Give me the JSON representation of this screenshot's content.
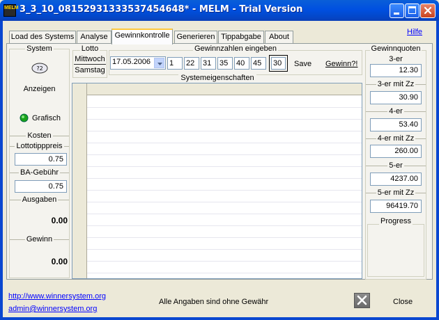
{
  "window": {
    "title": "3_3_10_08152931333537454648* - MELM - Trial Version",
    "icon_text": "MELM"
  },
  "tabs": [
    {
      "label": "Load des Systems",
      "active": false
    },
    {
      "label": "Analyse",
      "active": false
    },
    {
      "label": "Gewinnkontrolle",
      "active": true
    },
    {
      "label": "Generieren",
      "active": false
    },
    {
      "label": "Tippabgabe",
      "active": false
    },
    {
      "label": "About",
      "active": false
    }
  ],
  "help_link": "Hilfe",
  "system": {
    "group_label": "System",
    "show_label": "Anzeigen",
    "graphic_label": "Grafisch"
  },
  "costs": {
    "group_label": "Kosten",
    "lotto_price_label": "Lottotipppreis",
    "lotto_price_value": "0.75",
    "ba_fee_label": "BA-Gebühr",
    "ba_fee_value": "0.75",
    "expenses_label": "Ausgaben",
    "expenses_value": "0.00",
    "win_label": "Gewinn",
    "win_value": "0.00"
  },
  "lotto": {
    "group_label": "Lotto",
    "wednesday": "Mittwoch",
    "saturday": "Samstag"
  },
  "draw": {
    "group_label": "Gewinnzahlen eingeben",
    "date": "17.05.2006",
    "numbers": [
      "1",
      "22",
      "31",
      "35",
      "40",
      "45"
    ],
    "super": "30",
    "save_label": "Save",
    "win_button": "Gewinn?!"
  },
  "properties": {
    "label": "Systemeigenschaften"
  },
  "quotas": {
    "group_label": "Gewinnquoten",
    "items": [
      {
        "label": "3-er",
        "value": "12.30"
      },
      {
        "label": "3-er mit Zz",
        "value": "30.90"
      },
      {
        "label": "4-er",
        "value": "53.40"
      },
      {
        "label": "4-er mit Zz",
        "value": "260.00"
      },
      {
        "label": "5-er",
        "value": "4237.00"
      },
      {
        "label": "5-er mit Zz",
        "value": "96419.70"
      }
    ],
    "progress_label": "Progress"
  },
  "footer": {
    "website": "http://www.winnersystem.org",
    "email": "admin@winnersystem.org",
    "disclaimer": "Alle Angaben sind ohne Gewähr",
    "close_label": "Close"
  },
  "colors": {
    "titlebar": "#0050e0",
    "tab_highlight": "#ffc83c",
    "link": "#0000ff"
  }
}
